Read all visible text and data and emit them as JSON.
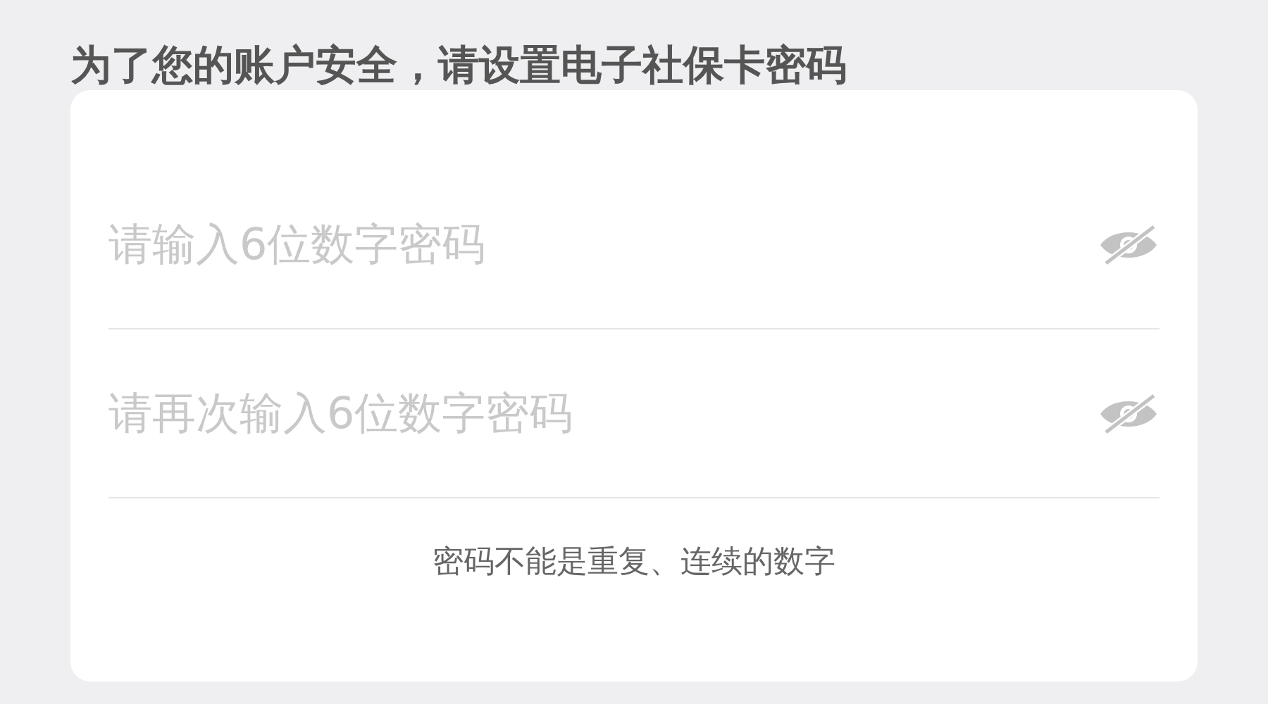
{
  "heading": "为了您的账户安全，请设置电子社保卡密码",
  "fields": [
    {
      "placeholder": "请输入6位数字密码",
      "visible": false
    },
    {
      "placeholder": "请再次输入6位数字密码",
      "visible": false
    }
  ],
  "hint": "密码不能是重复、连续的数字"
}
